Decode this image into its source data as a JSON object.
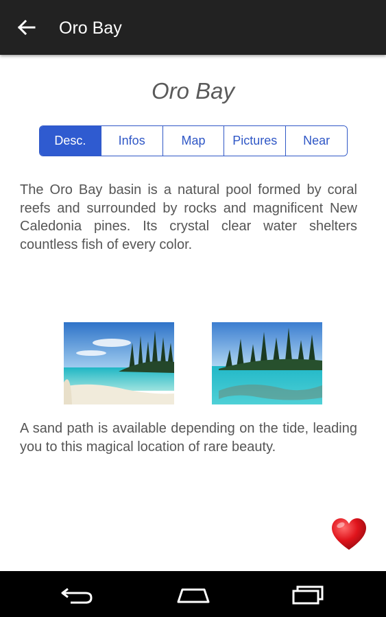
{
  "appbar": {
    "title": "Oro Bay"
  },
  "page": {
    "title": "Oro Bay"
  },
  "tabs": [
    {
      "label": "Desc.",
      "active": true
    },
    {
      "label": "Infos",
      "active": false
    },
    {
      "label": "Map",
      "active": false
    },
    {
      "label": "Pictures",
      "active": false
    },
    {
      "label": "Near",
      "active": false
    }
  ],
  "description": {
    "paragraph1": "The Oro Bay basin is a natural pool formed by coral reefs and surrounded by rocks and magnificent New Caledonia pines. Its crystal clear water shelters countless fish of every color.",
    "paragraph2": "A sand path is available depending on the tide, leading you to this magical location of rare beauty."
  },
  "icons": {
    "back": "arrow-left-icon",
    "favorite": "heart-icon",
    "nav_back": "nav-back-icon",
    "nav_home": "nav-home-icon",
    "nav_recent": "nav-recents-icon"
  },
  "colors": {
    "appbar": "#222222",
    "accent": "#2f5bd0",
    "text": "#555555",
    "heart": "#d8141c"
  }
}
